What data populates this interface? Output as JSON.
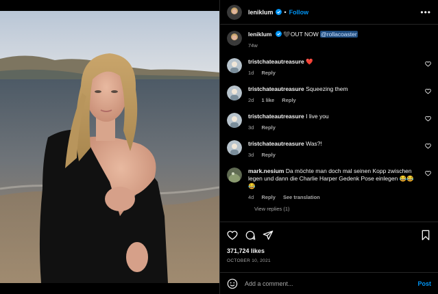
{
  "header": {
    "username": "leniklum",
    "dot": "•",
    "follow_label": "Follow",
    "more_label": "•••"
  },
  "caption": {
    "username": "leniklum",
    "text": "🖤OUT NOW",
    "mention": "@rollacoaster",
    "age": "74w"
  },
  "comments": [
    {
      "username": "tristchateautreasure",
      "text": "❤️",
      "age": "1d",
      "likes": "",
      "reply": "Reply"
    },
    {
      "username": "tristchateautreasure",
      "text": "Squeezing them",
      "age": "2d",
      "likes": "1 like",
      "reply": "Reply"
    },
    {
      "username": "tristchateautreasure",
      "text": "I live you",
      "age": "3d",
      "likes": "",
      "reply": "Reply"
    },
    {
      "username": "tristchateautreasure",
      "text": "Was?!",
      "age": "3d",
      "likes": "",
      "reply": "Reply"
    },
    {
      "username": "mark.nesium",
      "text": "Da möchte man doch mal seinen Kopp zwischen legen und dann die Charlie Harper Gedenk Pose einlegen 😂😂😂",
      "age": "4d",
      "likes": "",
      "reply": "Reply",
      "translate": "See translation"
    }
  ],
  "view_replies": "View replies (1)",
  "likes_count": "371,724 likes",
  "post_date": "OCTOBER 10, 2021",
  "add_comment": {
    "placeholder": "Add a comment...",
    "post_label": "Post"
  },
  "colors": {
    "accent": "#0095f6",
    "background": "#000000",
    "muted": "#a8a8a8",
    "heart": "#ff3040"
  },
  "icons": [
    "verified-badge-icon",
    "more-options-icon",
    "heart-icon",
    "comment-icon",
    "share-icon",
    "save-icon",
    "emoji-icon"
  ]
}
